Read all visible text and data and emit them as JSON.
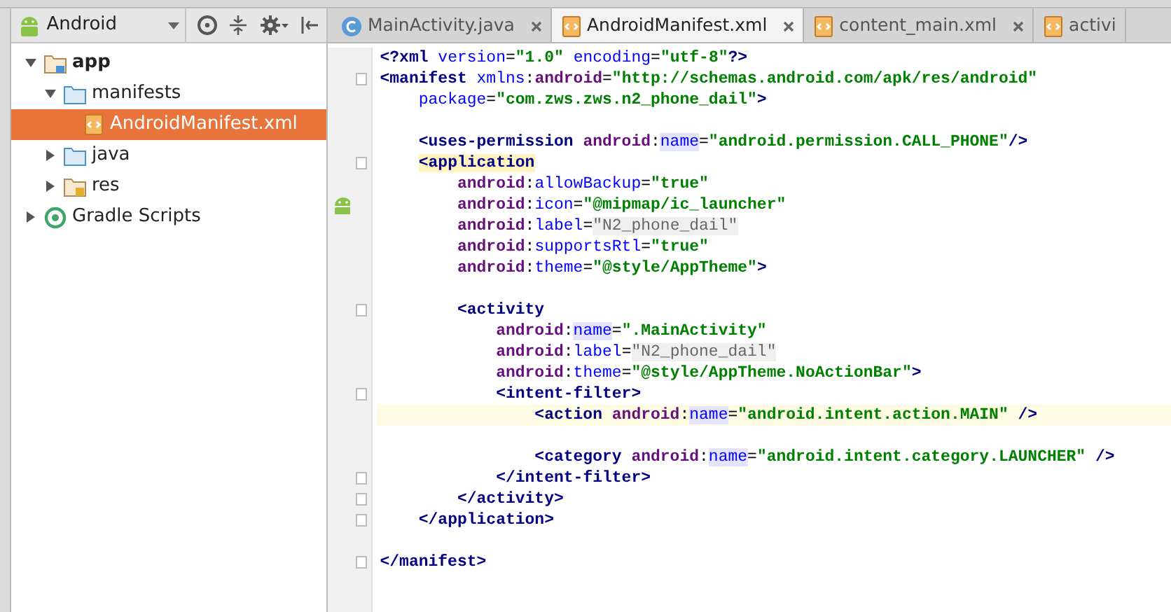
{
  "project_view": {
    "mode": "Android"
  },
  "tree": [
    {
      "label": "app",
      "kind": "module",
      "bold": true,
      "expanded": true,
      "selected": false,
      "children": [
        {
          "label": "manifests",
          "kind": "folder",
          "expanded": true,
          "selected": false,
          "children": [
            {
              "label": "AndroidManifest.xml",
              "kind": "xml",
              "selected": true
            }
          ]
        },
        {
          "label": "java",
          "kind": "folder",
          "expanded": false,
          "selected": false
        },
        {
          "label": "res",
          "kind": "res",
          "expanded": false,
          "selected": false
        }
      ]
    },
    {
      "label": "Gradle Scripts",
      "kind": "gradle",
      "expanded": false,
      "selected": false
    }
  ],
  "tabs": [
    {
      "label": "MainActivity.java",
      "kind": "java",
      "selected": false,
      "closable": true
    },
    {
      "label": "AndroidManifest.xml",
      "kind": "xml",
      "selected": true,
      "closable": true
    },
    {
      "label": "content_main.xml",
      "kind": "xml",
      "selected": false,
      "closable": true
    },
    {
      "label": "activi",
      "kind": "xml",
      "selected": false,
      "closable": false
    }
  ],
  "editor": {
    "lines": [
      {
        "kind": "code",
        "tokens": [
          {
            "kind": "tag",
            "text": "<?xml"
          },
          {
            "kind": "attr",
            "text": " version"
          },
          {
            "kind": "plain",
            "text": "="
          },
          {
            "kind": "value",
            "text": "\"1.0\""
          },
          {
            "kind": "attr",
            "text": " encoding"
          },
          {
            "kind": "plain",
            "text": "="
          },
          {
            "kind": "value",
            "text": "\"utf-8\""
          },
          {
            "kind": "tag",
            "text": "?>"
          }
        ]
      },
      {
        "kind": "code",
        "fold": true,
        "tokens": [
          {
            "kind": "tag",
            "text": "<manifest"
          },
          {
            "kind": "attr",
            "text": " xmlns"
          },
          {
            "kind": "plain",
            "text": ":"
          },
          {
            "kind": "ns",
            "text": "android"
          },
          {
            "kind": "plain",
            "text": "="
          },
          {
            "kind": "value",
            "text": "\"http://schemas.android.com/apk/res/android\""
          }
        ]
      },
      {
        "kind": "code",
        "tokens": [
          {
            "kind": "attr",
            "text": "    package"
          },
          {
            "kind": "plain",
            "text": "="
          },
          {
            "kind": "value",
            "text": "\"com.zws.zws.n2_phone_dail\""
          },
          {
            "kind": "tag",
            "text": ">"
          }
        ]
      },
      {
        "kind": "blank"
      },
      {
        "kind": "code",
        "tokens": [
          {
            "kind": "tag",
            "text": "    <uses-permission"
          },
          {
            "kind": "ns",
            "text": " android"
          },
          {
            "kind": "plain",
            "text": ":"
          },
          {
            "kind": "attr-hl",
            "text": "name"
          },
          {
            "kind": "plain",
            "text": "="
          },
          {
            "kind": "value",
            "text": "\"android.permission.CALL_PHONE\""
          },
          {
            "kind": "tag",
            "text": "/>"
          }
        ]
      },
      {
        "kind": "code",
        "fold": true,
        "tokens": [
          {
            "kind": "tag-match",
            "text": "    <application"
          }
        ]
      },
      {
        "kind": "code",
        "tokens": [
          {
            "kind": "ns",
            "text": "        android"
          },
          {
            "kind": "plain",
            "text": ":"
          },
          {
            "kind": "attr",
            "text": "allowBackup"
          },
          {
            "kind": "plain",
            "text": "="
          },
          {
            "kind": "value",
            "text": "\"true\""
          }
        ]
      },
      {
        "kind": "code",
        "gutter_icon": true,
        "tokens": [
          {
            "kind": "ns",
            "text": "        android"
          },
          {
            "kind": "plain",
            "text": ":"
          },
          {
            "kind": "attr",
            "text": "icon"
          },
          {
            "kind": "plain",
            "text": "="
          },
          {
            "kind": "value",
            "text": "\"@mipmap/ic_launcher\""
          }
        ]
      },
      {
        "kind": "code",
        "tokens": [
          {
            "kind": "ns",
            "text": "        android"
          },
          {
            "kind": "plain",
            "text": ":"
          },
          {
            "kind": "attr",
            "text": "label"
          },
          {
            "kind": "plain",
            "text": "="
          },
          {
            "kind": "folded",
            "text": "\"N2_phone_dail\""
          }
        ]
      },
      {
        "kind": "code",
        "tokens": [
          {
            "kind": "ns",
            "text": "        android"
          },
          {
            "kind": "plain",
            "text": ":"
          },
          {
            "kind": "attr",
            "text": "supportsRtl"
          },
          {
            "kind": "plain",
            "text": "="
          },
          {
            "kind": "value",
            "text": "\"true\""
          }
        ]
      },
      {
        "kind": "code",
        "tokens": [
          {
            "kind": "ns",
            "text": "        android"
          },
          {
            "kind": "plain",
            "text": ":"
          },
          {
            "kind": "attr",
            "text": "theme"
          },
          {
            "kind": "plain",
            "text": "="
          },
          {
            "kind": "value",
            "text": "\"@style/AppTheme\""
          },
          {
            "kind": "tag",
            "text": ">"
          }
        ]
      },
      {
        "kind": "blank"
      },
      {
        "kind": "code",
        "fold": true,
        "tokens": [
          {
            "kind": "tag",
            "text": "        <activity"
          }
        ]
      },
      {
        "kind": "code",
        "tokens": [
          {
            "kind": "ns",
            "text": "            android"
          },
          {
            "kind": "plain",
            "text": ":"
          },
          {
            "kind": "attr-hl",
            "text": "name"
          },
          {
            "kind": "plain",
            "text": "="
          },
          {
            "kind": "value",
            "text": "\".MainActivity\""
          }
        ]
      },
      {
        "kind": "code",
        "tokens": [
          {
            "kind": "ns",
            "text": "            android"
          },
          {
            "kind": "plain",
            "text": ":"
          },
          {
            "kind": "attr",
            "text": "label"
          },
          {
            "kind": "plain",
            "text": "="
          },
          {
            "kind": "folded",
            "text": "\"N2_phone_dail\""
          }
        ]
      },
      {
        "kind": "code",
        "tokens": [
          {
            "kind": "ns",
            "text": "            android"
          },
          {
            "kind": "plain",
            "text": ":"
          },
          {
            "kind": "attr",
            "text": "theme"
          },
          {
            "kind": "plain",
            "text": "="
          },
          {
            "kind": "value",
            "text": "\"@style/AppTheme.NoActionBar\""
          },
          {
            "kind": "tag",
            "text": ">"
          }
        ]
      },
      {
        "kind": "code",
        "fold": true,
        "tokens": [
          {
            "kind": "tag",
            "text": "            <intent-filter>"
          }
        ]
      },
      {
        "kind": "code",
        "current": true,
        "tokens": [
          {
            "kind": "tag",
            "text": "                <action"
          },
          {
            "kind": "ns",
            "text": " android"
          },
          {
            "kind": "plain",
            "text": ":"
          },
          {
            "kind": "attr-hl",
            "text": "name"
          },
          {
            "kind": "plain",
            "text": "="
          },
          {
            "kind": "value",
            "text": "\"android.intent.action.MAIN\""
          },
          {
            "kind": "tag",
            "text": " />"
          }
        ]
      },
      {
        "kind": "blank"
      },
      {
        "kind": "code",
        "tokens": [
          {
            "kind": "tag",
            "text": "                <category"
          },
          {
            "kind": "ns",
            "text": " android"
          },
          {
            "kind": "plain",
            "text": ":"
          },
          {
            "kind": "attr-hl",
            "text": "name"
          },
          {
            "kind": "plain",
            "text": "="
          },
          {
            "kind": "value",
            "text": "\"android.intent.category.LAUNCHER\""
          },
          {
            "kind": "tag",
            "text": " />"
          }
        ]
      },
      {
        "kind": "code",
        "fold": true,
        "tokens": [
          {
            "kind": "tag",
            "text": "            </intent-filter>"
          }
        ]
      },
      {
        "kind": "code",
        "fold": true,
        "tokens": [
          {
            "kind": "tag",
            "text": "        </activity>"
          }
        ]
      },
      {
        "kind": "code",
        "fold": true,
        "tokens": [
          {
            "kind": "tag",
            "text": "    </application>"
          }
        ]
      },
      {
        "kind": "blank"
      },
      {
        "kind": "code",
        "fold": true,
        "tokens": [
          {
            "kind": "tag",
            "text": "</manifest>"
          }
        ]
      }
    ]
  }
}
